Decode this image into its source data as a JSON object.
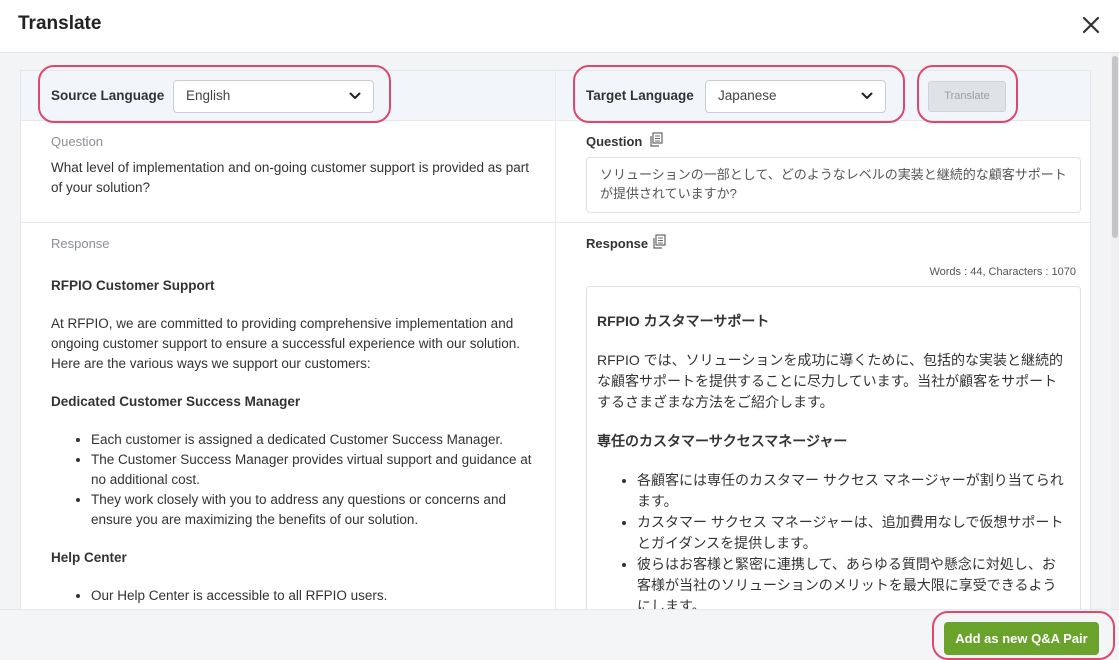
{
  "header": {
    "title": "Translate"
  },
  "source": {
    "label": "Source Language",
    "value": "English"
  },
  "target": {
    "label": "Target Language",
    "value": "Japanese"
  },
  "translate_button": "Translate",
  "question": {
    "label_left": "Question",
    "text_left": "What level of implementation and on-going customer support is provided as part of your solution?",
    "label_right": "Question",
    "text_right": "ソリューションの一部として、どのようなレベルの実装と継続的な顧客サポートが提供されていますか?"
  },
  "response": {
    "label_left": "Response",
    "label_right": "Response",
    "stats": "Words : 44, Characters : 1070",
    "left": {
      "h1": "RFPIO Customer Support",
      "p1": "At RFPIO, we are committed to providing comprehensive implementation and ongoing customer support to ensure a successful experience with our solution. Here are the various ways we support our customers:",
      "h2": "Dedicated Customer Success Manager",
      "b1": "Each customer is assigned a dedicated Customer Success Manager.",
      "b2": "The Customer Success Manager provides virtual support and guidance at no additional cost.",
      "b3": "They work closely with you to address any questions or concerns and ensure you are maximizing the benefits of our solution.",
      "h3": "Help Center",
      "b4": "Our Help Center is accessible to all RFPIO users."
    },
    "right": {
      "h1": "RFPIO カスタマーサポート",
      "p1": "RFPIO では、ソリューションを成功に導くために、包括的な実装と継続的な顧客サポートを提供することに尽力しています。当社が顧客をサポートするさまざまな方法をご紹介します。",
      "h2": "専任のカスタマーサクセスマネージャー",
      "b1": "各顧客には専任のカスタマー サクセス マネージャーが割り当てられます。",
      "b2": "カスタマー サクセス マネージャーは、追加費用なしで仮想サポートとガイダンスを提供します。",
      "b3": "彼らはお客様と緊密に連携して、あらゆる質問や懸念に対処し、お客様が当社のソリューションのメリットを最大限に享受できるようにします。"
    }
  },
  "footer": {
    "add_button": "Add as new Q&A Pair"
  },
  "icons": {
    "close": "close-icon",
    "chevron": "chevron-down-icon",
    "copy": "copy-icon"
  },
  "colors": {
    "accent_green": "#6aa32c",
    "highlight": "#e0476c",
    "bar_bg": "#f2f6fa"
  }
}
